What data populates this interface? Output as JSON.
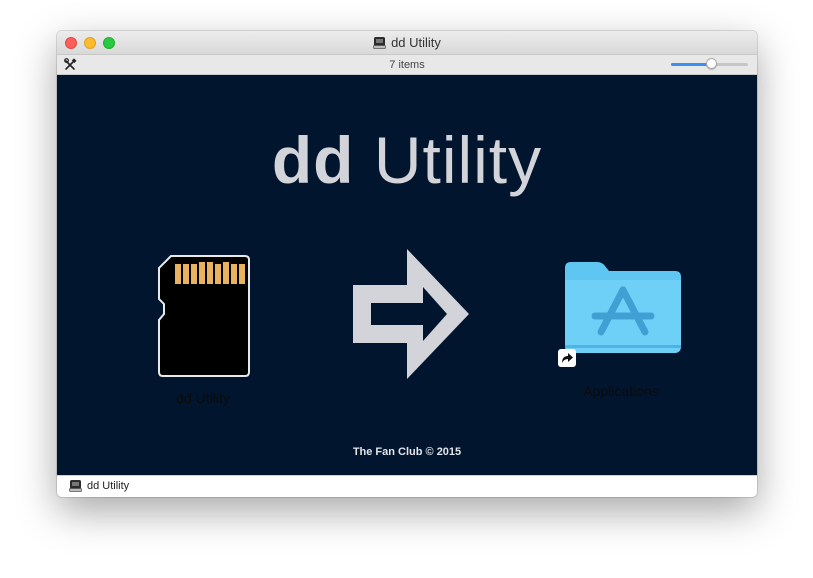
{
  "window": {
    "title": "dd Utility",
    "title_icon": "drive-icon"
  },
  "toolbar": {
    "item_count": "7 items",
    "icon_size_slider": 0.53
  },
  "background": {
    "title_bold": "dd",
    "title_regular": " Utility",
    "credit": "The Fan Club © 2015"
  },
  "icons": [
    {
      "label": "dd Utility",
      "icon": "sd-card-icon"
    },
    {
      "label": "Applications",
      "icon": "applications-folder-icon"
    }
  ],
  "pathbar": {
    "label": "dd Utility",
    "icon": "drive-icon"
  },
  "colors": {
    "background": "#01162e",
    "sd_card_contacts": "#e9b35d",
    "folder": "#5fc6f2",
    "slider_fill": "#3b8ef4"
  }
}
